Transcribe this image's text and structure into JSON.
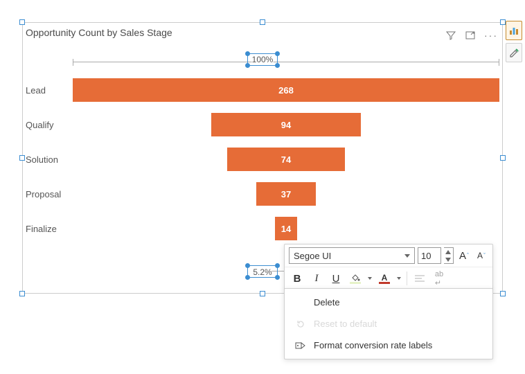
{
  "title": "Opportunity Count by Sales Stage",
  "pct_top": "100%",
  "pct_bottom": "5.2%",
  "chart_data": {
    "type": "bar",
    "orientation": "funnel-horizontal",
    "title": "Opportunity Count by Sales Stage",
    "categories": [
      "Lead",
      "Qualify",
      "Solution",
      "Proposal",
      "Finalize"
    ],
    "values": [
      268,
      94,
      74,
      37,
      14
    ],
    "conversion_top_pct": 100,
    "conversion_bottom_pct": 5.2,
    "bar_color": "#E66C37"
  },
  "toolbar": {
    "font_family": "Segoe UI",
    "font_size": "10",
    "buttons": {
      "increase": "A",
      "increase_sup": "ˆ",
      "decrease": "A",
      "decrease_sup": "ˇ",
      "bold": "B",
      "italic": "I",
      "underline": "U"
    },
    "fill_color": "#E6F2C8",
    "font_color": "#C0392B"
  },
  "context_menu": {
    "delete": "Delete",
    "reset": "Reset to default",
    "format_labels": "Format conversion rate labels"
  }
}
